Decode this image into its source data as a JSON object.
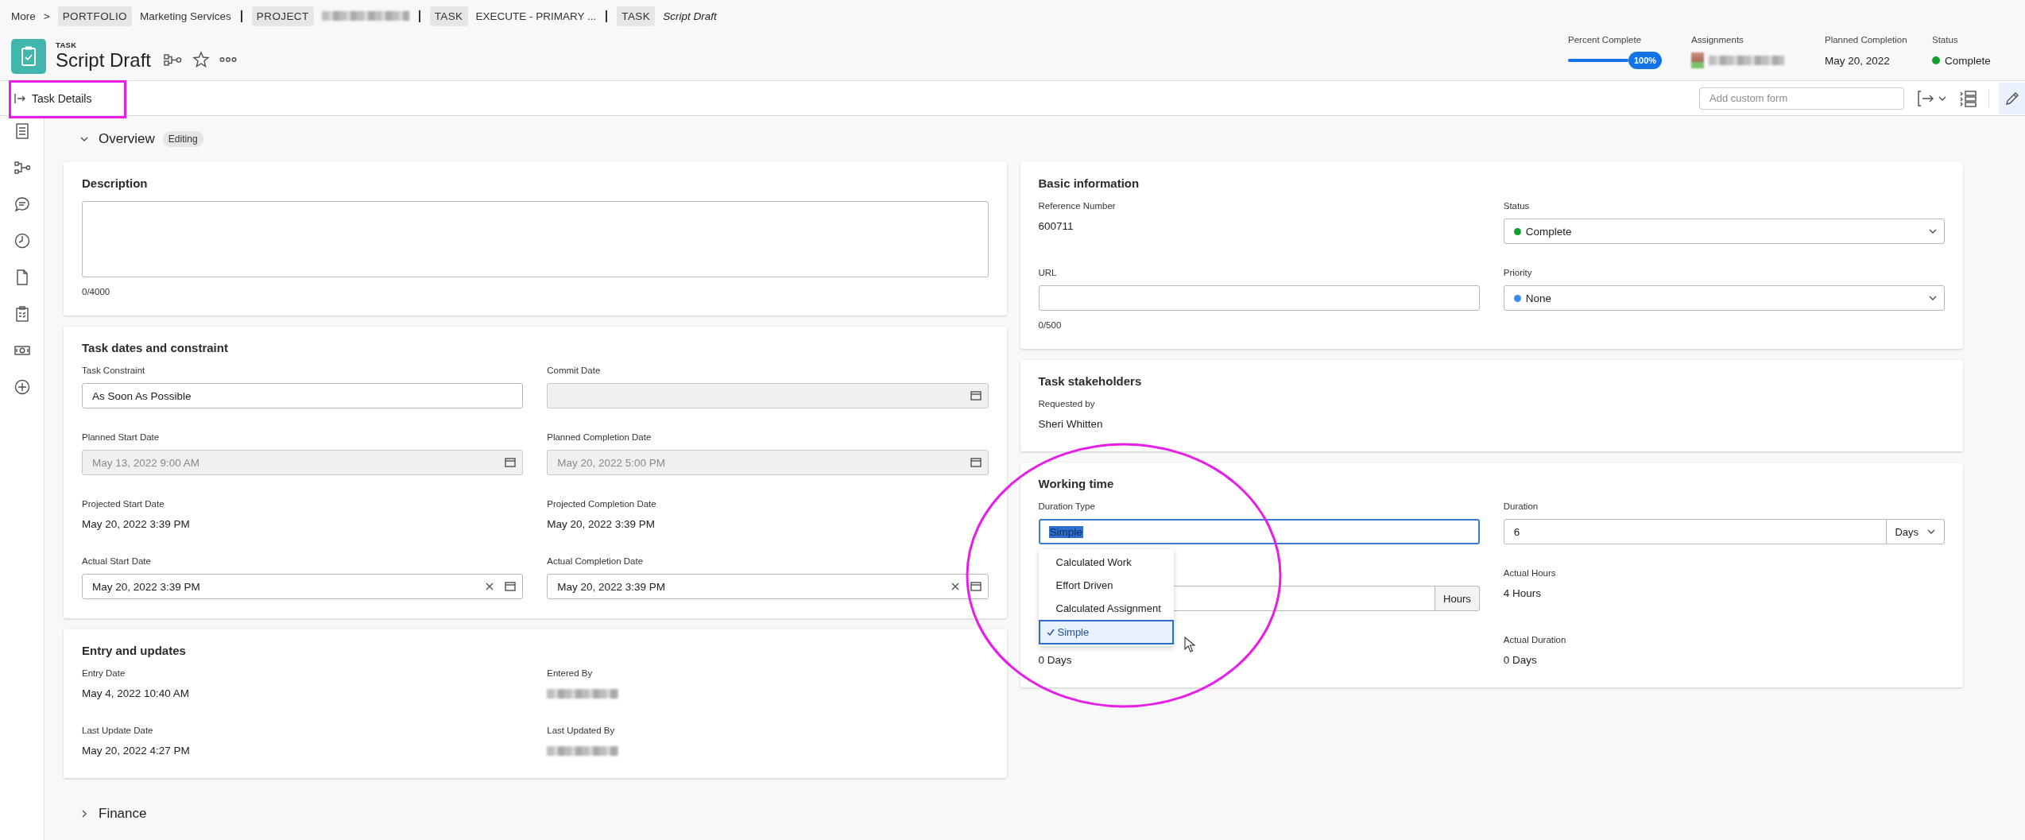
{
  "breadcrumb": {
    "more": "More",
    "separator": ">",
    "items": [
      {
        "tag": "PORTFOLIO",
        "text": "Marketing Services",
        "current": false
      },
      {
        "tag": "PROJECT",
        "current": false
      },
      {
        "tag": "TASK",
        "text": "EXECUTE - PRIMARY ...",
        "current": false
      },
      {
        "tag": "TASK",
        "text": "Script Draft",
        "current": true
      }
    ]
  },
  "header": {
    "object_type": "TASK",
    "title": "Script Draft",
    "metrics": [
      {
        "kind": "progress",
        "label": "Percent Complete",
        "level": 1,
        "reading": "100%"
      },
      {
        "kind": "assignee",
        "label": "Assignments"
      },
      {
        "kind": "text",
        "label": "Planned Completion",
        "value": "May 20, 2022"
      },
      {
        "kind": "status",
        "label": "Status",
        "value": "Complete",
        "color": "#12a12f"
      }
    ]
  },
  "toolbar": {
    "title": "Task Details",
    "custom_form": {
      "placeholder": "Add custom form"
    }
  },
  "sections": [
    {
      "title": "Overview",
      "badge": "Editing",
      "expanded": true
    },
    {
      "title": "Finance",
      "expanded": false
    }
  ],
  "columns": {
    "left": [
      {
        "title": "Description",
        "fields": [
          {
            "kind": "textarea",
            "counter": "0/4000",
            "disabled": false,
            "focused": false
          }
        ]
      },
      {
        "title": "Task dates and constraint",
        "fields": [
          {
            "kind": "input",
            "label": "Task Constraint",
            "value": "As Soon As Possible",
            "disabled": false,
            "focused": false
          },
          {
            "kind": "date",
            "label": "Commit Date",
            "disabled": true,
            "focused": false,
            "clearable": false
          },
          {
            "kind": "date",
            "label": "Planned Start Date",
            "value": "May 13, 2022 9:00 AM",
            "disabled": true,
            "focused": false,
            "clearable": false
          },
          {
            "kind": "date",
            "label": "Planned Completion Date",
            "value": "May 20, 2022 5:00 PM",
            "disabled": true,
            "focused": false,
            "clearable": false
          },
          {
            "kind": "value",
            "label": "Projected Start Date",
            "value": "May 20, 2022 3:39 PM"
          },
          {
            "kind": "value",
            "label": "Projected Completion Date",
            "value": "May 20, 2022 3:39 PM"
          },
          {
            "kind": "date",
            "label": "Actual Start Date",
            "value": "May 20, 2022 3:39 PM",
            "disabled": false,
            "focused": false,
            "clearable": true
          },
          {
            "kind": "date",
            "label": "Actual Completion Date",
            "value": "May 20, 2022 3:39 PM",
            "disabled": false,
            "focused": false,
            "clearable": true
          }
        ]
      },
      {
        "title": "Entry and updates",
        "fields": [
          {
            "kind": "value",
            "label": "Entry Date",
            "value": "May 4, 2022 10:40 AM"
          },
          {
            "kind": "blurred",
            "label": "Entered By"
          },
          {
            "kind": "value",
            "label": "Last Update Date",
            "value": "May 20, 2022 4:27 PM"
          },
          {
            "kind": "blurred",
            "label": "Last Updated By"
          }
        ]
      }
    ],
    "right": [
      {
        "title": "Basic information",
        "fields": [
          {
            "kind": "value",
            "label": "Reference Number",
            "value": "600711"
          },
          {
            "kind": "select",
            "label": "Status",
            "value": "Complete",
            "color": "#12a12f"
          },
          {
            "kind": "input",
            "label": "URL",
            "counter": "0/500",
            "disabled": false,
            "focused": false
          },
          {
            "kind": "select",
            "label": "Priority",
            "value": "None",
            "color": "#3b8ced"
          }
        ]
      },
      {
        "title": "Task stakeholders",
        "fields": [
          {
            "kind": "value",
            "label": "Requested by",
            "value": "Sheri Whitten"
          }
        ]
      },
      {
        "title": "Working time",
        "fields": [
          {
            "kind": "input",
            "label": "Duration Type",
            "value": "Simple",
            "disabled": false,
            "focused": true,
            "options": [
              {
                "label": "Calculated Work",
                "selected": false
              },
              {
                "label": "Effort Driven",
                "selected": false
              },
              {
                "label": "Calculated Assignment",
                "selected": false
              },
              {
                "label": "Simple",
                "selected": true
              }
            ]
          },
          {
            "kind": "unit-select",
            "label": "Duration",
            "value": "6",
            "unit": "Days",
            "disabled": false,
            "focused": false
          },
          {
            "kind": "unit-suffix",
            "unit": "Hours",
            "disabled": false,
            "focused": false
          },
          {
            "kind": "value",
            "label": "Actual Hours",
            "value": "4 Hours"
          },
          {
            "kind": "value",
            "value": "0 Days"
          },
          {
            "kind": "value",
            "label": "Actual Duration",
            "value": "0 Days"
          }
        ]
      }
    ]
  }
}
